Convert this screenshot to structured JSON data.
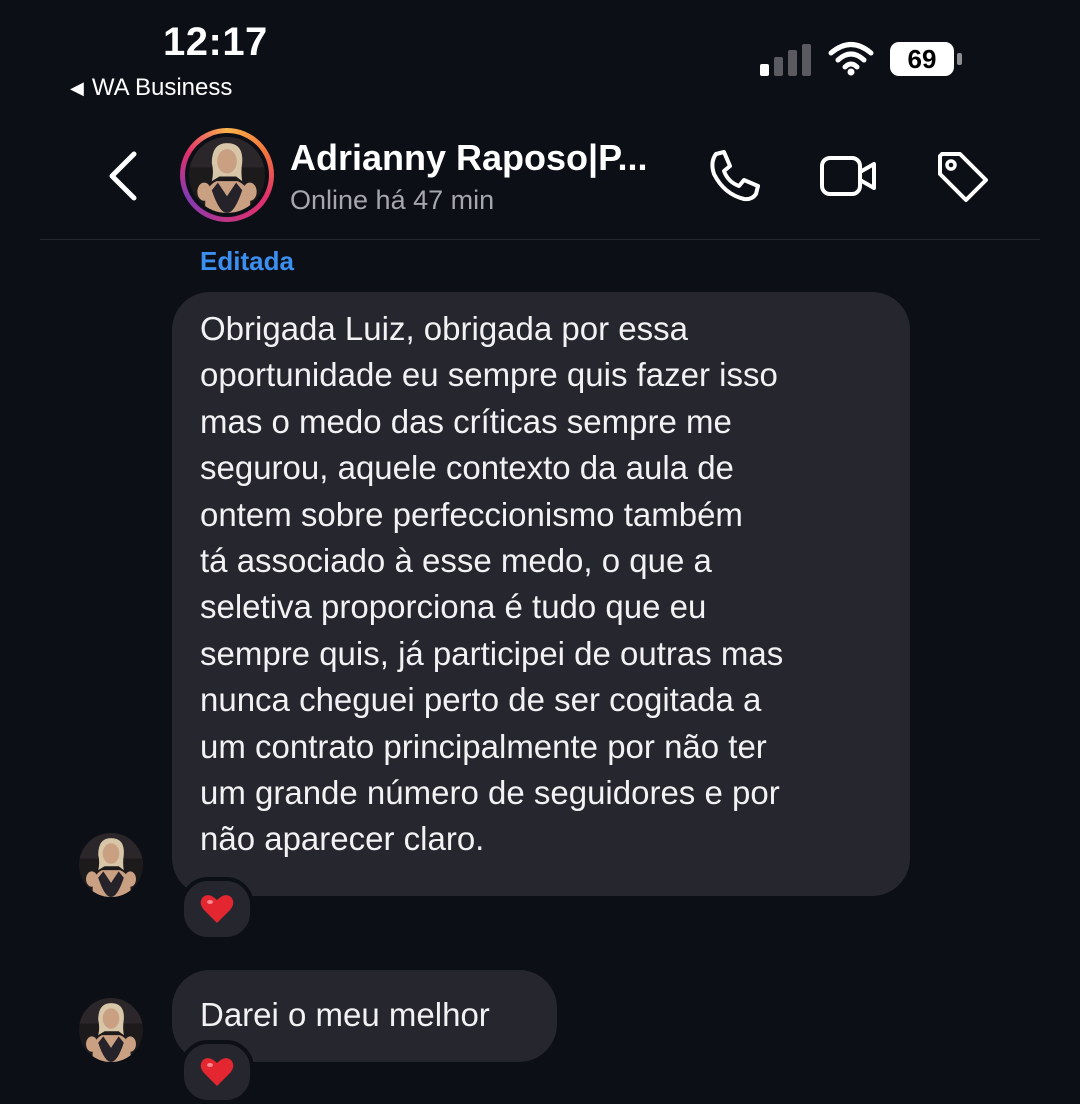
{
  "status_bar": {
    "time": "12:17",
    "back_app": "WA Business",
    "battery": "69",
    "signal_icon": "cellular-signal-icon",
    "wifi_icon": "wifi-icon"
  },
  "header": {
    "contact_name": "Adrianny Raposo|P...",
    "status": "Online há 47 min",
    "icons": [
      "chevron-left-icon",
      "phone-icon",
      "video-camera-icon",
      "tag-icon"
    ],
    "avatar_ring_colors": [
      "#fdb44b",
      "#f3733a",
      "#e1306c",
      "#c13584",
      "#833ab4"
    ]
  },
  "messages": [
    {
      "edited_label": "Editada",
      "lines": [
        "Obrigada Luiz, obrigada por essa",
        "oportunidade eu sempre quis fazer isso",
        "mas o medo das críticas sempre me",
        "segurou, aquele contexto da aula de",
        "ontem sobre perfeccionismo também",
        "tá associado à esse medo, o que a",
        "seletiva proporciona é tudo que eu",
        "sempre quis, já participei de outras mas",
        "nunca cheguei perto de ser cogitada a",
        "um contrato principalmente por não ter",
        "um grande número de seguidores e por",
        "não aparecer claro."
      ],
      "reaction": "❤️"
    },
    {
      "text": "Darei o meu melhor",
      "reaction": "❤️"
    }
  ],
  "colors": {
    "background": "#0d0f17",
    "bubble": "#26272e",
    "edited_label": "#3b8ff0",
    "secondary_text": "#a6a6ad"
  }
}
